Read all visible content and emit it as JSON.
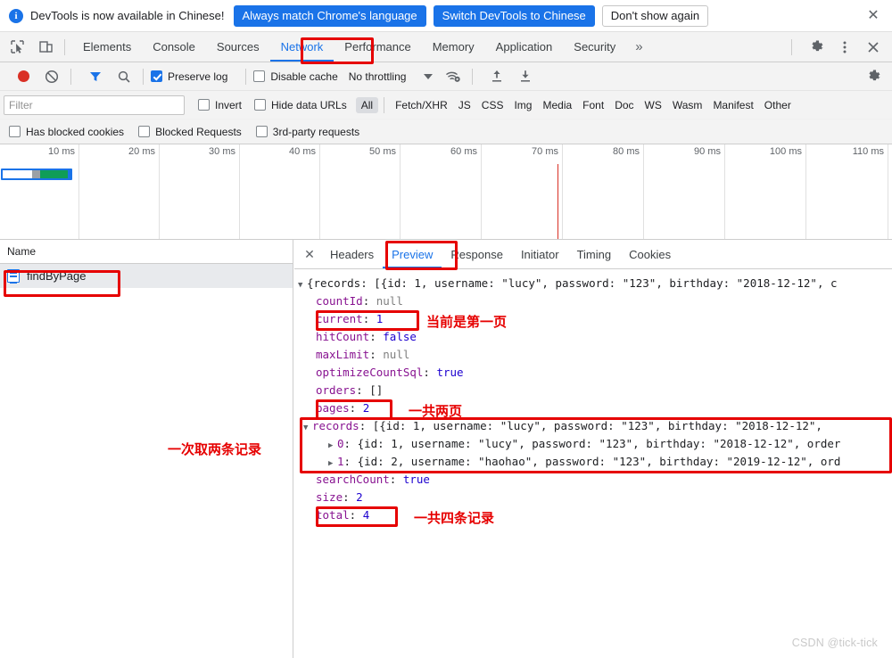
{
  "banner": {
    "icon": "info-icon",
    "message": "DevTools is now available in Chinese!",
    "primary_button": "Always match Chrome's language",
    "secondary_button": "Switch DevTools to Chinese",
    "dismiss_button": "Don't show again",
    "close_icon": "close-icon"
  },
  "devtools_tabs": {
    "inspect_icon": "inspect-element-icon",
    "device_icon": "device-toolbar-icon",
    "items": [
      {
        "label": "Elements",
        "active": false
      },
      {
        "label": "Console",
        "active": false
      },
      {
        "label": "Sources",
        "active": false
      },
      {
        "label": "Network",
        "active": true
      },
      {
        "label": "Performance",
        "active": false
      },
      {
        "label": "Memory",
        "active": false
      },
      {
        "label": "Application",
        "active": false
      },
      {
        "label": "Security",
        "active": false
      }
    ],
    "more_label": "»",
    "settings_icon": "gear-icon",
    "kebab_icon": "more-vertical-icon",
    "close_icon": "close-icon"
  },
  "network_toolbar": {
    "record_icon": "record-stop-icon",
    "clear_icon": "clear-icon",
    "filter_icon": "filter-funnel-icon",
    "search_icon": "search-icon",
    "preserve_log": {
      "label": "Preserve log",
      "checked": true
    },
    "disable_cache": {
      "label": "Disable cache",
      "checked": false
    },
    "throttling": {
      "value": "No throttling",
      "caret_icon": "chevron-down-icon"
    },
    "wifi_icon": "network-conditions-icon",
    "import_icon": "upload-arrow-icon",
    "export_icon": "download-arrow-icon",
    "settings_icon": "gear-icon"
  },
  "filters": {
    "search_placeholder": "Filter",
    "search_value": "",
    "invert": {
      "label": "Invert",
      "checked": false
    },
    "hide_data_urls": {
      "label": "Hide data URLs",
      "checked": false
    },
    "types": [
      {
        "label": "All",
        "selected": true
      },
      {
        "label": "Fetch/XHR",
        "selected": false
      },
      {
        "label": "JS",
        "selected": false
      },
      {
        "label": "CSS",
        "selected": false
      },
      {
        "label": "Img",
        "selected": false
      },
      {
        "label": "Media",
        "selected": false
      },
      {
        "label": "Font",
        "selected": false
      },
      {
        "label": "Doc",
        "selected": false
      },
      {
        "label": "WS",
        "selected": false
      },
      {
        "label": "Wasm",
        "selected": false
      },
      {
        "label": "Manifest",
        "selected": false
      },
      {
        "label": "Other",
        "selected": false
      }
    ],
    "toggles": [
      {
        "label": "Has blocked cookies",
        "checked": false
      },
      {
        "label": "Blocked Requests",
        "checked": false
      },
      {
        "label": "3rd-party requests",
        "checked": false
      }
    ]
  },
  "overview": {
    "ticks": [
      "10 ms",
      "20 ms",
      "30 ms",
      "40 ms",
      "50 ms",
      "60 ms",
      "70 ms",
      "80 ms",
      "90 ms",
      "100 ms",
      "110 ms"
    ]
  },
  "request_list": {
    "column_header": "Name",
    "rows": [
      {
        "icon": "document-icon",
        "name": "findByPage",
        "selected": true
      }
    ]
  },
  "detail_tabs": {
    "close_icon": "close-icon",
    "items": [
      {
        "label": "Headers",
        "active": false
      },
      {
        "label": "Preview",
        "active": true
      },
      {
        "label": "Response",
        "active": false
      },
      {
        "label": "Initiator",
        "active": false
      },
      {
        "label": "Timing",
        "active": false
      },
      {
        "label": "Cookies",
        "active": false
      }
    ]
  },
  "preview": {
    "root_line": {
      "expander": "▼",
      "text": "{records: [{id: 1, username: \"lucy\", password: \"123\", birthday: \"2018-12-12\", c"
    },
    "properties": [
      {
        "key": "countId",
        "value": "null",
        "kind": "null"
      },
      {
        "key": "current",
        "value": "1",
        "kind": "num"
      },
      {
        "key": "hitCount",
        "value": "false",
        "kind": "kw"
      },
      {
        "key": "maxLimit",
        "value": "null",
        "kind": "null"
      },
      {
        "key": "optimizeCountSql",
        "value": "true",
        "kind": "kw"
      },
      {
        "key": "orders",
        "value": "[]",
        "kind": "punc"
      },
      {
        "key": "pages",
        "value": "2",
        "kind": "num"
      }
    ],
    "records_line": {
      "expander": "▼",
      "key": "records",
      "text": " [{id: 1, username: \"lucy\", password: \"123\", birthday: \"2018-12-12\","
    },
    "records_children": [
      {
        "expander": "▶",
        "index": "0",
        "text": "{id: 1, username: \"lucy\", password: \"123\", birthday: \"2018-12-12\", order"
      },
      {
        "expander": "▶",
        "index": "1",
        "text": "{id: 2, username: \"haohao\", password: \"123\", birthday: \"2019-12-12\", ord"
      }
    ],
    "properties_tail": [
      {
        "key": "searchCount",
        "value": "true",
        "kind": "kw"
      },
      {
        "key": "size",
        "value": "2",
        "kind": "num"
      },
      {
        "key": "total",
        "value": "4",
        "kind": "num"
      }
    ]
  },
  "annotations": [
    {
      "text": "当前是第一页",
      "target": "current"
    },
    {
      "text": "一共两页",
      "target": "pages"
    },
    {
      "text": "一次取两条记录",
      "target": "records"
    },
    {
      "text": "一共四条记录",
      "target": "total"
    }
  ],
  "watermark": "CSDN @tick-tick",
  "colors": {
    "accent": "#1a73e8",
    "annotation_red": "#e60000",
    "record_red": "#d93025",
    "timeline_green": "#0f9d58",
    "key_purple": "#881391",
    "value_blue": "#1c00cf"
  }
}
